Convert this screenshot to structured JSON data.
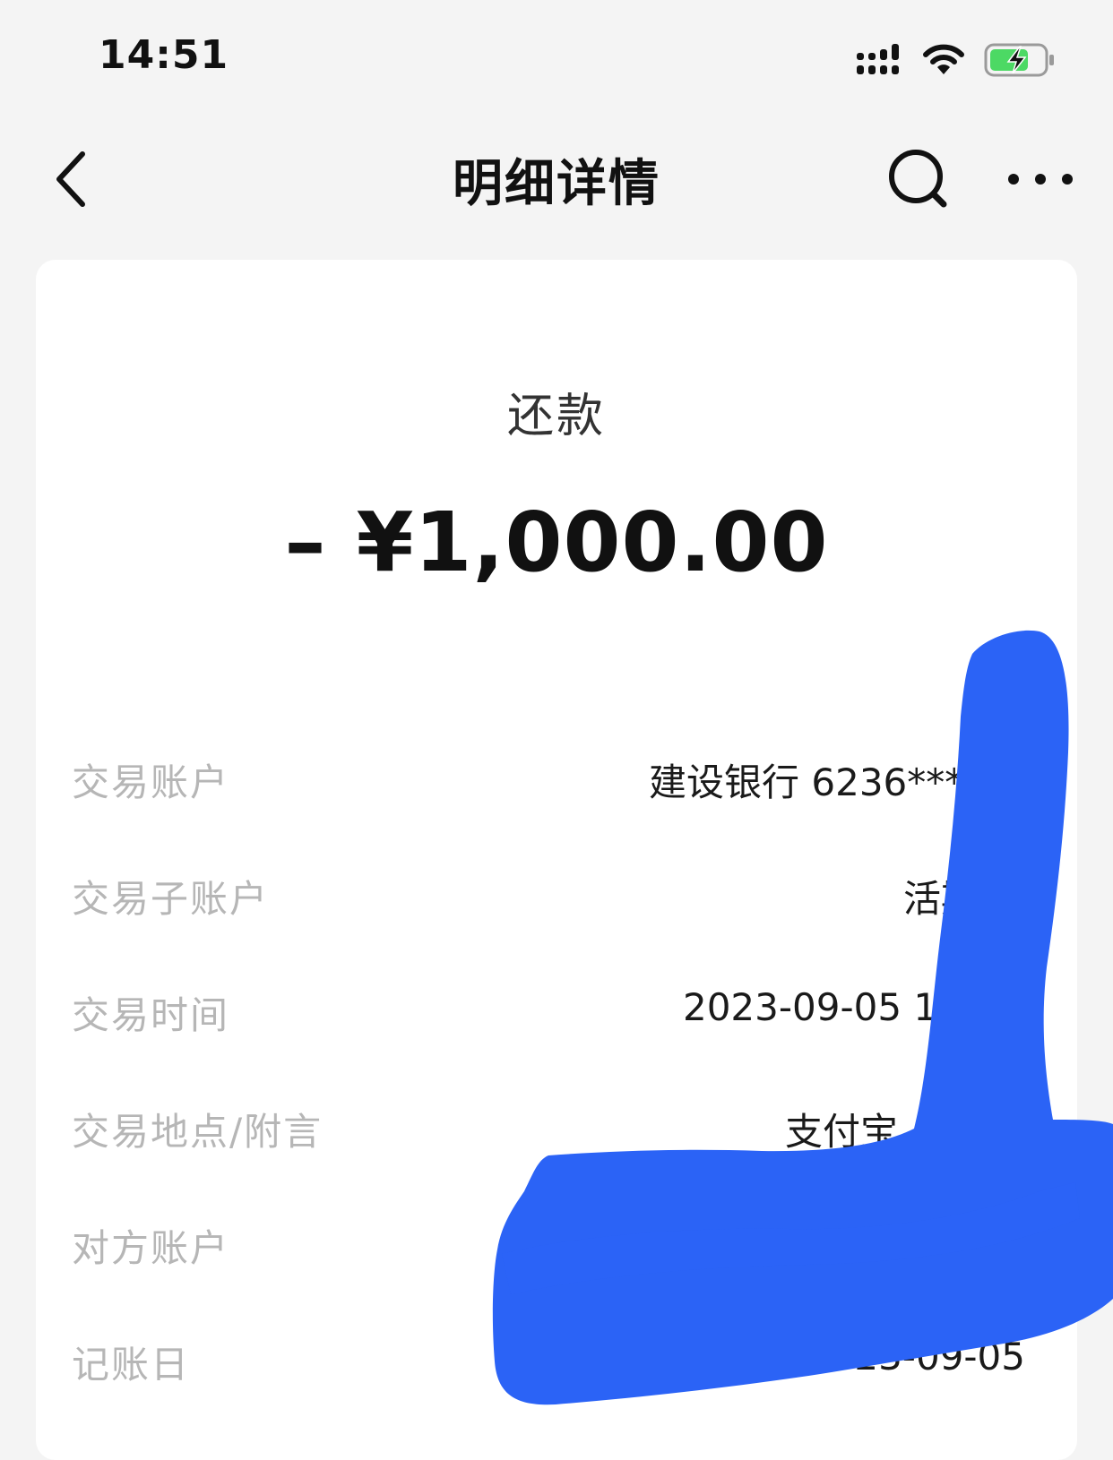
{
  "status_bar": {
    "time": "14:51",
    "icons": [
      "signal-icon",
      "wifi-icon",
      "battery-charging-icon"
    ],
    "battery_color": "#4cd964"
  },
  "nav": {
    "title": "明细详情",
    "icons": [
      "back-chevron-icon",
      "search-icon",
      "more-dots-icon"
    ]
  },
  "transaction": {
    "type": "还款",
    "amount": "– ¥1,000.00"
  },
  "fields": [
    {
      "label": "交易账户",
      "value": "建设银行 6236***6"
    },
    {
      "label": "交易子账户",
      "value": "活期"
    },
    {
      "label": "交易时间",
      "value": "2023-09-05 14:"
    },
    {
      "label": "交易地点/附言",
      "value": "支付宝"
    },
    {
      "label": "对方账户",
      "value": ""
    },
    {
      "label": "记账日",
      "value": "2023-09-05"
    }
  ],
  "colors": {
    "background": "#f4f4f4",
    "card": "#ffffff",
    "label_gray": "#b6b6b6",
    "redaction_blue": "#2b63f6"
  }
}
